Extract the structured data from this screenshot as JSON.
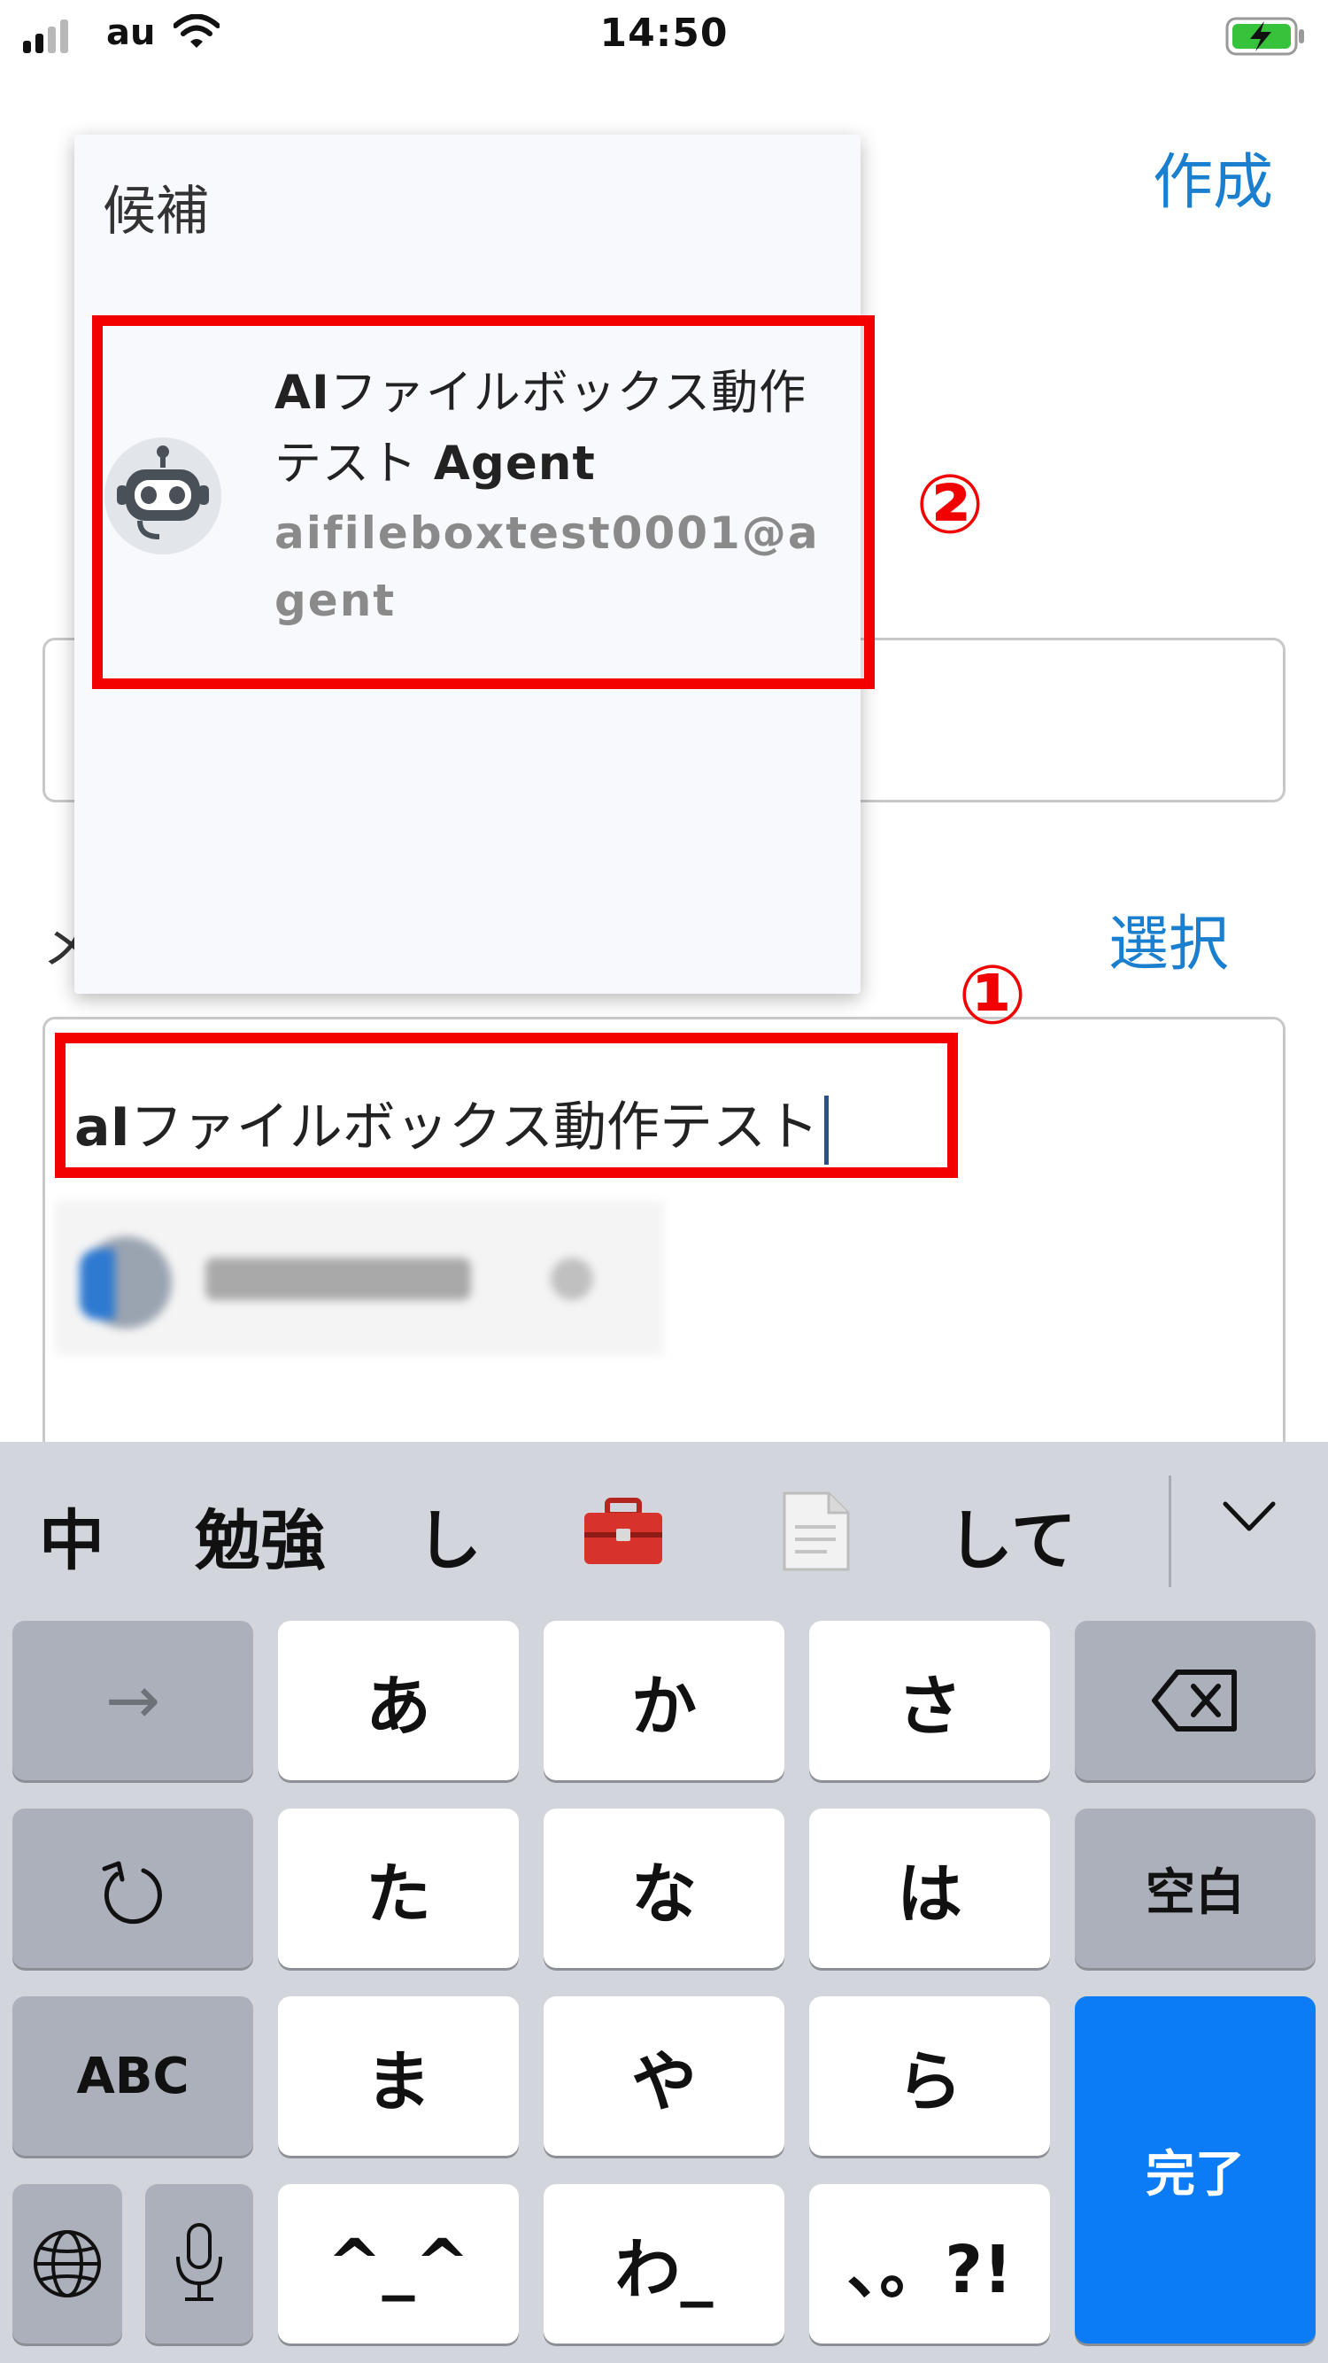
{
  "status_bar": {
    "carrier": "au",
    "time": "14:50"
  },
  "form": {
    "create_label": "作成",
    "member_label_partial": "メ",
    "select_label": "選択",
    "search_bold": "aI",
    "search_rest": "ファイルボックス動作テスト"
  },
  "suggestions": {
    "title": "候補",
    "items": [
      {
        "name_bold": "AI",
        "name_mid": "ファイルボックス動作テスト ",
        "name_agent": "Agent",
        "email": "aifileboxtest0001@agent"
      }
    ]
  },
  "annotations": {
    "marker_1": "①",
    "marker_2": "②"
  },
  "keyboard": {
    "candidates": [
      "中",
      "勉強",
      "し",
      "して"
    ],
    "keys": {
      "row1": [
        "→",
        "あ",
        "か",
        "さ"
      ],
      "row2": [
        "た",
        "な",
        "は",
        "空白"
      ],
      "row3": [
        "ABC",
        "ま",
        "や",
        "ら",
        "完了"
      ],
      "row4": [
        "^_^",
        "わ_",
        "、。?!"
      ]
    }
  },
  "colors": {
    "accent_blue": "#1a7fcf",
    "annotation_red": "#f20000",
    "done_key": "#0b7cf6",
    "keyboard_bg": "#d2d5db"
  },
  "icons": [
    "signal-icon",
    "wifi-icon",
    "battery-charging-icon",
    "robot-icon",
    "toolbox-emoji-icon",
    "document-emoji-icon",
    "chevron-down-icon",
    "undo-icon",
    "backspace-icon",
    "globe-icon",
    "microphone-icon"
  ]
}
